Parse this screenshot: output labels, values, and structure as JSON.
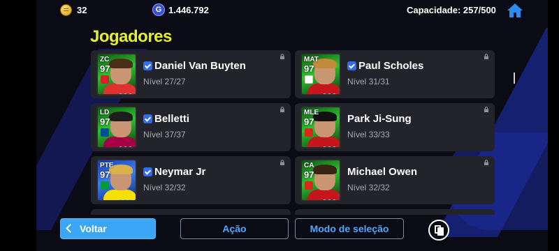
{
  "topbar": {
    "coins": "32",
    "gp": "1.446.792",
    "gp_icon_letter": "G",
    "capacity": "Capacidade: 257/500",
    "icons": [
      "coin-icon",
      "gp-icon",
      "home-icon"
    ]
  },
  "title": "Jogadores",
  "players": [
    {
      "position": "ZC",
      "rating": "97",
      "name": "Daniel Van Buyten",
      "verified": true,
      "level": "Nível 27/27",
      "shirt_color": "#e03030",
      "badge_color": "#d8202a"
    },
    {
      "position": "MAT",
      "rating": "97",
      "name": "Paul Scholes",
      "verified": true,
      "level": "Nível 31/31",
      "shirt_color": "#c4161c",
      "badge_color": "#ffffff"
    },
    {
      "position": "LD",
      "rating": "97",
      "name": "Belletti",
      "verified": true,
      "level": "Nível 37/37",
      "shirt_color": "#a50044",
      "badge_color": "#004d98"
    },
    {
      "position": "MLE",
      "rating": "97",
      "name": "Park Ji-Sung",
      "verified": false,
      "level": "Nível 33/33",
      "shirt_color": "#c4161c",
      "badge_color": "#da291c"
    },
    {
      "position": "PTE",
      "rating": "97",
      "name": "Neymar Jr",
      "verified": true,
      "level": "Nível 32/32",
      "shirt_color": "#f7e000",
      "badge_color": "#009c3b"
    },
    {
      "position": "CA",
      "rating": "97",
      "name": "Michael Owen",
      "verified": false,
      "level": "Nível 32/32",
      "shirt_color": "#c4161c",
      "badge_color": "#da291c"
    }
  ],
  "buttons": {
    "back": "Voltar",
    "action": "Ação",
    "selection_mode": "Modo de seleção"
  },
  "colors": {
    "title": "#e7ef2c",
    "accent_blue": "#3aa6f4",
    "card_bg": "#23232c",
    "link_blue": "#4da9ff"
  }
}
